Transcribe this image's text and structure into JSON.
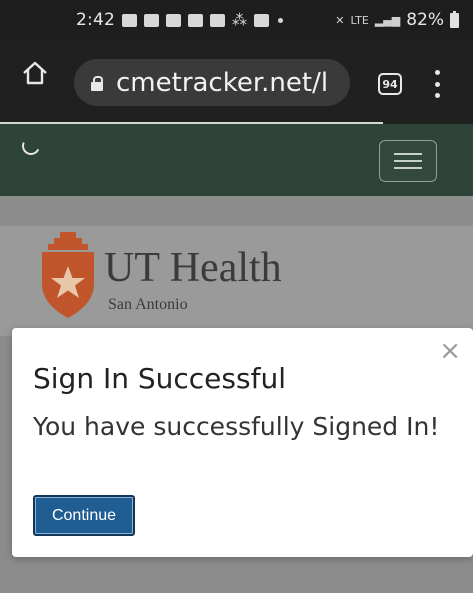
{
  "status_bar": {
    "time": "2:42",
    "battery": "82%",
    "network": "LTE"
  },
  "browser": {
    "url": "cmetracker.net/l",
    "tab_count": "94"
  },
  "logo": {
    "name": "UT Health",
    "location": "San Antonio",
    "shield_color": "#c0542a"
  },
  "modal": {
    "close_label": "×",
    "title": "Sign In Successful",
    "message": "You have successfully Signed In!",
    "continue_label": "Continue"
  },
  "colors": {
    "navbar": "#2e4438",
    "button": "#1f5d93"
  }
}
